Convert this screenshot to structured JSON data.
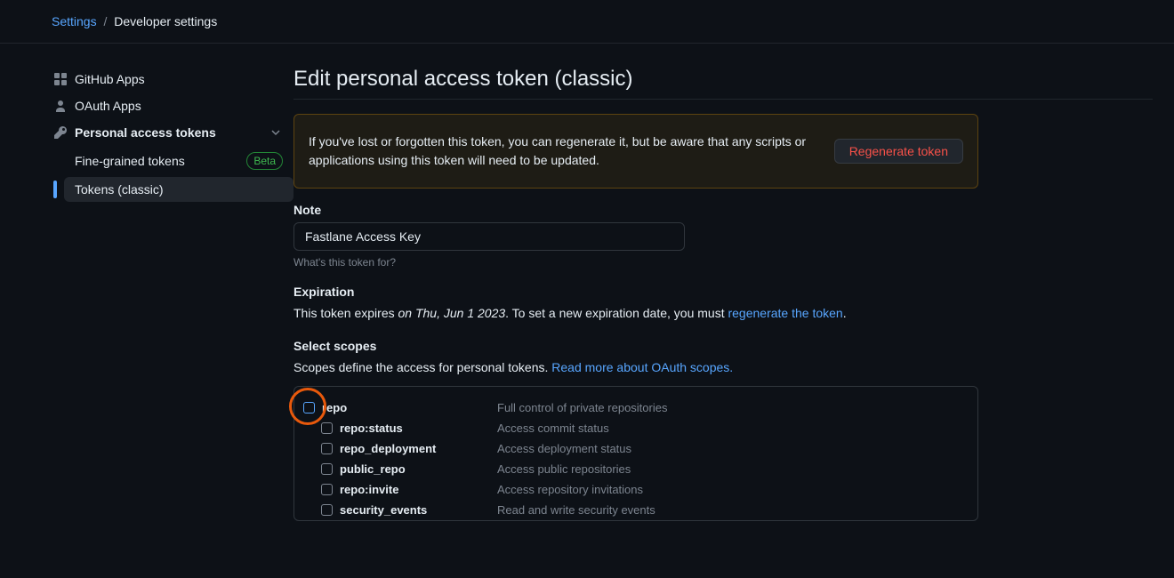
{
  "breadcrumb": {
    "settings": "Settings",
    "dev": "Developer settings"
  },
  "sidebar": {
    "github_apps": "GitHub Apps",
    "oauth_apps": "OAuth Apps",
    "pat": "Personal access tokens",
    "fine_grained": "Fine-grained tokens",
    "beta": "Beta",
    "classic": "Tokens (classic)"
  },
  "page": {
    "title": "Edit personal access token (classic)",
    "flash": "If you've lost or forgotten this token, you can regenerate it, but be aware that any scripts or applications using this token will need to be updated.",
    "regen_btn": "Regenerate token",
    "note_label": "Note",
    "note_value": "Fastlane Access Key",
    "note_hint": "What's this token for?",
    "exp_label": "Expiration",
    "exp_prefix": "This token expires ",
    "exp_date": "on Thu, Jun 1 2023",
    "exp_mid": ". To set a new expiration date, you must ",
    "exp_link": "regenerate the token",
    "exp_suffix": ".",
    "scopes_label": "Select scopes",
    "scopes_desc_pre": "Scopes define the access for personal tokens. ",
    "scopes_link": "Read more about OAuth scopes.",
    "scopes": {
      "repo": {
        "name": "repo",
        "desc": "Full control of private repositories"
      },
      "status": {
        "name": "repo:status",
        "desc": "Access commit status"
      },
      "deploy": {
        "name": "repo_deployment",
        "desc": "Access deployment status"
      },
      "public": {
        "name": "public_repo",
        "desc": "Access public repositories"
      },
      "invite": {
        "name": "repo:invite",
        "desc": "Access repository invitations"
      },
      "security": {
        "name": "security_events",
        "desc": "Read and write security events"
      }
    }
  }
}
